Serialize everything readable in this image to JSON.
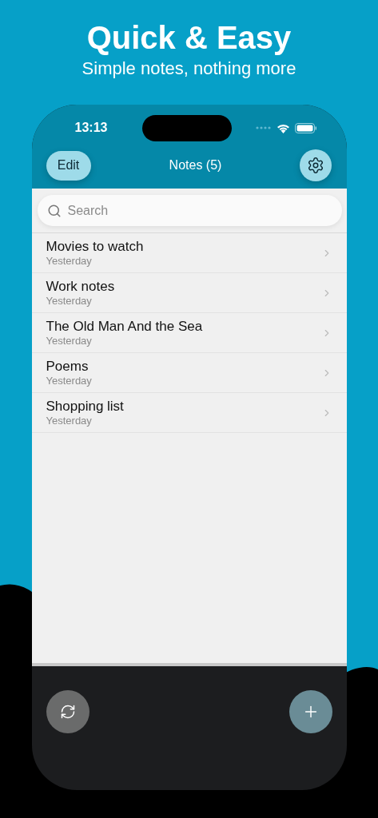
{
  "promo": {
    "title": "Quick & Easy",
    "subtitle": "Simple notes, nothing more"
  },
  "status_bar": {
    "time": "13:13"
  },
  "nav": {
    "edit_button": "Edit",
    "title": "Notes (5)"
  },
  "search": {
    "placeholder": "Search"
  },
  "notes": [
    {
      "title": "Movies to watch",
      "date": "Yesterday"
    },
    {
      "title": "Work notes",
      "date": "Yesterday"
    },
    {
      "title": "The Old Man And the Sea",
      "date": "Yesterday"
    },
    {
      "title": "Poems",
      "date": "Yesterday"
    },
    {
      "title": "Shopping list",
      "date": "Yesterday"
    }
  ]
}
